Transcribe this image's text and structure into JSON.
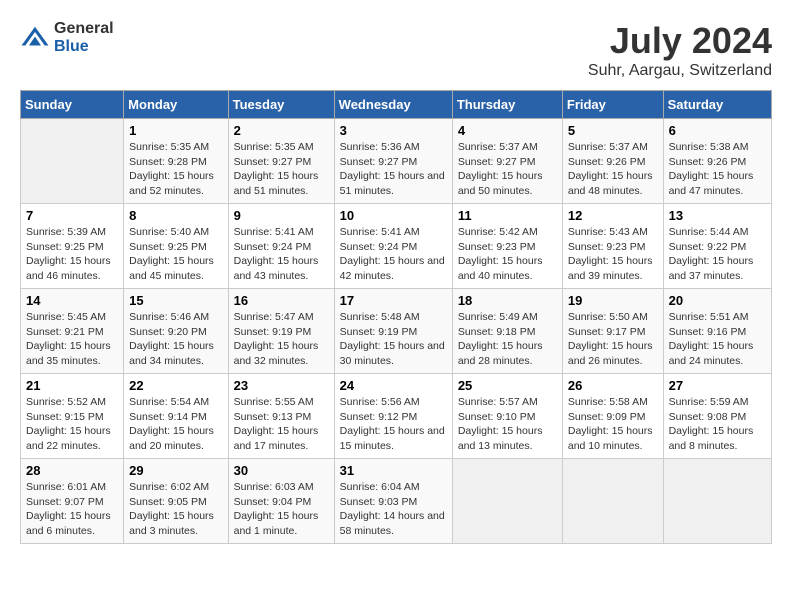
{
  "header": {
    "logo_general": "General",
    "logo_blue": "Blue",
    "title": "July 2024",
    "subtitle": "Suhr, Aargau, Switzerland"
  },
  "days_of_week": [
    "Sunday",
    "Monday",
    "Tuesday",
    "Wednesday",
    "Thursday",
    "Friday",
    "Saturday"
  ],
  "weeks": [
    [
      {
        "day": "",
        "empty": true
      },
      {
        "day": "1",
        "sunrise": "Sunrise: 5:35 AM",
        "sunset": "Sunset: 9:28 PM",
        "daylight": "Daylight: 15 hours and 52 minutes."
      },
      {
        "day": "2",
        "sunrise": "Sunrise: 5:35 AM",
        "sunset": "Sunset: 9:27 PM",
        "daylight": "Daylight: 15 hours and 51 minutes."
      },
      {
        "day": "3",
        "sunrise": "Sunrise: 5:36 AM",
        "sunset": "Sunset: 9:27 PM",
        "daylight": "Daylight: 15 hours and 51 minutes."
      },
      {
        "day": "4",
        "sunrise": "Sunrise: 5:37 AM",
        "sunset": "Sunset: 9:27 PM",
        "daylight": "Daylight: 15 hours and 50 minutes."
      },
      {
        "day": "5",
        "sunrise": "Sunrise: 5:37 AM",
        "sunset": "Sunset: 9:26 PM",
        "daylight": "Daylight: 15 hours and 48 minutes."
      },
      {
        "day": "6",
        "sunrise": "Sunrise: 5:38 AM",
        "sunset": "Sunset: 9:26 PM",
        "daylight": "Daylight: 15 hours and 47 minutes."
      }
    ],
    [
      {
        "day": "7",
        "sunrise": "Sunrise: 5:39 AM",
        "sunset": "Sunset: 9:25 PM",
        "daylight": "Daylight: 15 hours and 46 minutes."
      },
      {
        "day": "8",
        "sunrise": "Sunrise: 5:40 AM",
        "sunset": "Sunset: 9:25 PM",
        "daylight": "Daylight: 15 hours and 45 minutes."
      },
      {
        "day": "9",
        "sunrise": "Sunrise: 5:41 AM",
        "sunset": "Sunset: 9:24 PM",
        "daylight": "Daylight: 15 hours and 43 minutes."
      },
      {
        "day": "10",
        "sunrise": "Sunrise: 5:41 AM",
        "sunset": "Sunset: 9:24 PM",
        "daylight": "Daylight: 15 hours and 42 minutes."
      },
      {
        "day": "11",
        "sunrise": "Sunrise: 5:42 AM",
        "sunset": "Sunset: 9:23 PM",
        "daylight": "Daylight: 15 hours and 40 minutes."
      },
      {
        "day": "12",
        "sunrise": "Sunrise: 5:43 AM",
        "sunset": "Sunset: 9:23 PM",
        "daylight": "Daylight: 15 hours and 39 minutes."
      },
      {
        "day": "13",
        "sunrise": "Sunrise: 5:44 AM",
        "sunset": "Sunset: 9:22 PM",
        "daylight": "Daylight: 15 hours and 37 minutes."
      }
    ],
    [
      {
        "day": "14",
        "sunrise": "Sunrise: 5:45 AM",
        "sunset": "Sunset: 9:21 PM",
        "daylight": "Daylight: 15 hours and 35 minutes."
      },
      {
        "day": "15",
        "sunrise": "Sunrise: 5:46 AM",
        "sunset": "Sunset: 9:20 PM",
        "daylight": "Daylight: 15 hours and 34 minutes."
      },
      {
        "day": "16",
        "sunrise": "Sunrise: 5:47 AM",
        "sunset": "Sunset: 9:19 PM",
        "daylight": "Daylight: 15 hours and 32 minutes."
      },
      {
        "day": "17",
        "sunrise": "Sunrise: 5:48 AM",
        "sunset": "Sunset: 9:19 PM",
        "daylight": "Daylight: 15 hours and 30 minutes."
      },
      {
        "day": "18",
        "sunrise": "Sunrise: 5:49 AM",
        "sunset": "Sunset: 9:18 PM",
        "daylight": "Daylight: 15 hours and 28 minutes."
      },
      {
        "day": "19",
        "sunrise": "Sunrise: 5:50 AM",
        "sunset": "Sunset: 9:17 PM",
        "daylight": "Daylight: 15 hours and 26 minutes."
      },
      {
        "day": "20",
        "sunrise": "Sunrise: 5:51 AM",
        "sunset": "Sunset: 9:16 PM",
        "daylight": "Daylight: 15 hours and 24 minutes."
      }
    ],
    [
      {
        "day": "21",
        "sunrise": "Sunrise: 5:52 AM",
        "sunset": "Sunset: 9:15 PM",
        "daylight": "Daylight: 15 hours and 22 minutes."
      },
      {
        "day": "22",
        "sunrise": "Sunrise: 5:54 AM",
        "sunset": "Sunset: 9:14 PM",
        "daylight": "Daylight: 15 hours and 20 minutes."
      },
      {
        "day": "23",
        "sunrise": "Sunrise: 5:55 AM",
        "sunset": "Sunset: 9:13 PM",
        "daylight": "Daylight: 15 hours and 17 minutes."
      },
      {
        "day": "24",
        "sunrise": "Sunrise: 5:56 AM",
        "sunset": "Sunset: 9:12 PM",
        "daylight": "Daylight: 15 hours and 15 minutes."
      },
      {
        "day": "25",
        "sunrise": "Sunrise: 5:57 AM",
        "sunset": "Sunset: 9:10 PM",
        "daylight": "Daylight: 15 hours and 13 minutes."
      },
      {
        "day": "26",
        "sunrise": "Sunrise: 5:58 AM",
        "sunset": "Sunset: 9:09 PM",
        "daylight": "Daylight: 15 hours and 10 minutes."
      },
      {
        "day": "27",
        "sunrise": "Sunrise: 5:59 AM",
        "sunset": "Sunset: 9:08 PM",
        "daylight": "Daylight: 15 hours and 8 minutes."
      }
    ],
    [
      {
        "day": "28",
        "sunrise": "Sunrise: 6:01 AM",
        "sunset": "Sunset: 9:07 PM",
        "daylight": "Daylight: 15 hours and 6 minutes."
      },
      {
        "day": "29",
        "sunrise": "Sunrise: 6:02 AM",
        "sunset": "Sunset: 9:05 PM",
        "daylight": "Daylight: 15 hours and 3 minutes."
      },
      {
        "day": "30",
        "sunrise": "Sunrise: 6:03 AM",
        "sunset": "Sunset: 9:04 PM",
        "daylight": "Daylight: 15 hours and 1 minute."
      },
      {
        "day": "31",
        "sunrise": "Sunrise: 6:04 AM",
        "sunset": "Sunset: 9:03 PM",
        "daylight": "Daylight: 14 hours and 58 minutes."
      },
      {
        "day": "",
        "empty": true
      },
      {
        "day": "",
        "empty": true
      },
      {
        "day": "",
        "empty": true
      }
    ]
  ]
}
